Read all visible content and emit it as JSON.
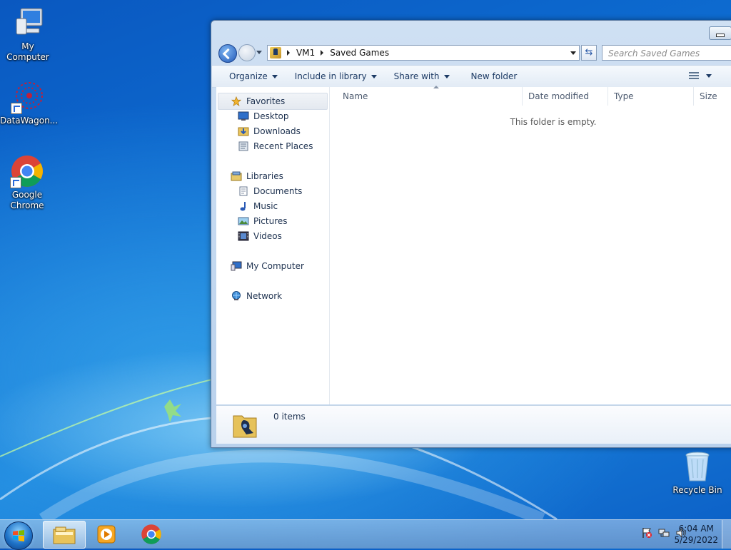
{
  "desktop": {
    "icons": [
      {
        "label": "My Computer"
      },
      {
        "label": "DataWagon..."
      },
      {
        "label": "Google Chrome"
      }
    ],
    "recycle_bin": "Recycle Bin"
  },
  "window": {
    "breadcrumb": [
      "VM1",
      "Saved Games"
    ],
    "search_placeholder": "Search Saved Games",
    "toolbar": {
      "organize": "Organize",
      "include": "Include in library",
      "share": "Share with",
      "new_folder": "New folder"
    },
    "nav": {
      "favorites": "Favorites",
      "desktop": "Desktop",
      "downloads": "Downloads",
      "recent": "Recent Places",
      "libraries": "Libraries",
      "documents": "Documents",
      "music": "Music",
      "pictures": "Pictures",
      "videos": "Videos",
      "computer": "My Computer",
      "network": "Network"
    },
    "columns": [
      "Name",
      "Date modified",
      "Type",
      "Size"
    ],
    "empty_message": "This folder is empty.",
    "status": "0 items"
  },
  "taskbar": {
    "time": "6:04 AM",
    "date": "5/29/2022"
  },
  "colors": {
    "desktop_blue": "#0d6bd0",
    "window_frame": "#b9d1ec",
    "accent": "#2259b8"
  }
}
